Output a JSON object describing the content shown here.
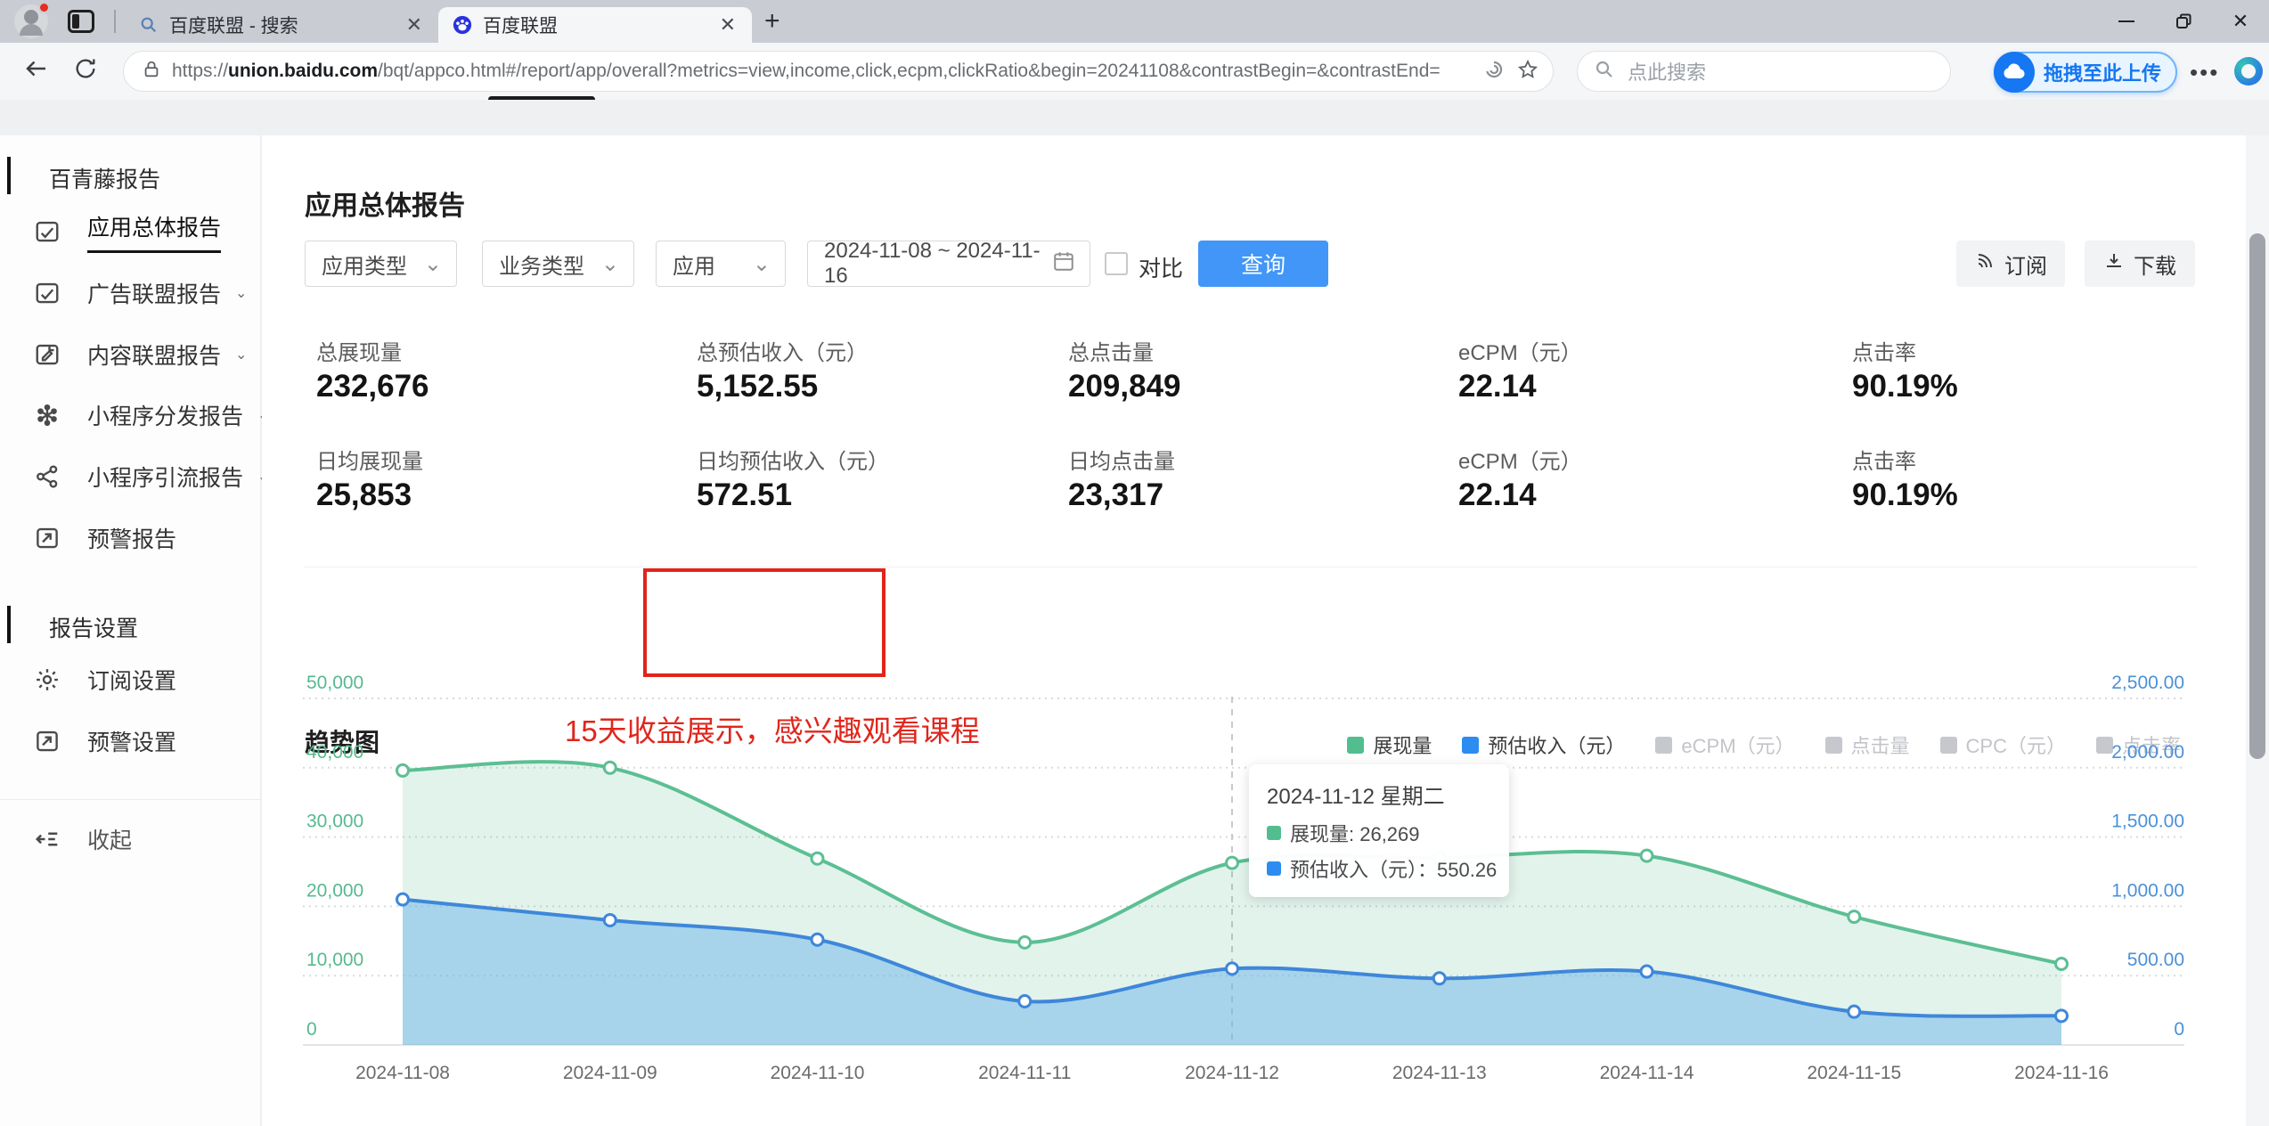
{
  "browser": {
    "tabs": [
      {
        "title": "百度联盟 - 搜索",
        "favicon": "search-icon",
        "active": false
      },
      {
        "title": "百度联盟",
        "favicon": "baidu-paw-icon",
        "active": true
      }
    ],
    "url_scheme": "https://",
    "url_host": "union.baidu.com",
    "url_path": "/bqt/appco.html#/report/app/overall?metrics=view,income,click,ecpm,clickRatio&begin=20241108&contrastBegin=&contrastEnd=",
    "search_placeholder": "点此搜索",
    "upload_label": "拖拽至此上传"
  },
  "sidebar": {
    "section_report": "百青藤报告",
    "items": [
      {
        "label": "应用总体报告",
        "icon": "report-chart-icon",
        "active": true,
        "expandable": false
      },
      {
        "label": "广告联盟报告",
        "icon": "report-chart-icon",
        "active": false,
        "expandable": true
      },
      {
        "label": "内容联盟报告",
        "icon": "content-report-icon",
        "active": false,
        "expandable": true
      },
      {
        "label": "小程序分发报告",
        "icon": "mini-program-distribute-icon",
        "active": false,
        "expandable": true
      },
      {
        "label": "小程序引流报告",
        "icon": "share-icon",
        "active": false,
        "expandable": true
      },
      {
        "label": "预警报告",
        "icon": "alert-report-icon",
        "active": false,
        "expandable": false
      }
    ],
    "section_settings": "报告设置",
    "settings_items": [
      {
        "label": "订阅设置",
        "icon": "gear-icon"
      },
      {
        "label": "预警设置",
        "icon": "alert-report-icon"
      }
    ],
    "collapse_label": "收起"
  },
  "main": {
    "page_title": "应用总体报告",
    "filters": {
      "app_type": "应用类型",
      "biz_type": "业务类型",
      "app": "应用",
      "date_range": "2024-11-08 ~ 2024-11-16",
      "compare_label": "对比",
      "query_label": "查询",
      "subscribe_label": "订阅",
      "download_label": "下载"
    },
    "stats": {
      "row1": [
        {
          "label": "总展现量",
          "value": "232,676"
        },
        {
          "label": "总预估收入（元）",
          "value": "5,152.55"
        },
        {
          "label": "总点击量",
          "value": "209,849"
        },
        {
          "label": "eCPM（元）",
          "value": "22.14"
        },
        {
          "label": "点击率",
          "value": "90.19%"
        }
      ],
      "row2": [
        {
          "label": "日均展现量",
          "value": "25,853"
        },
        {
          "label": "日均预估收入（元）",
          "value": "572.51",
          "highlighted": true
        },
        {
          "label": "日均点击量",
          "value": "23,317"
        },
        {
          "label": "eCPM（元）",
          "value": "22.14"
        },
        {
          "label": "点击率",
          "value": "90.19%"
        }
      ]
    },
    "annotation": "15天收益展示，感兴趣观看课程",
    "chart_title": "趋势图",
    "highlight_color": "#e0251b"
  },
  "chart_data": {
    "type": "area",
    "title": "趋势图",
    "x": [
      "2024-11-08",
      "2024-11-09",
      "2024-11-10",
      "2024-11-11",
      "2024-11-12",
      "2024-11-13",
      "2024-11-14",
      "2024-11-15",
      "2024-11-16"
    ],
    "series": [
      {
        "name": "展现量",
        "axis": "left",
        "color": "#52be90",
        "line_color": "#5cbf93",
        "fill": "rgba(92,191,147,0.18)",
        "values": [
          39600,
          40000,
          26900,
          14800,
          26269,
          27000,
          27300,
          18500,
          11700
        ]
      },
      {
        "name": "预估收入（元）",
        "axis": "right",
        "color": "#2d8cf0",
        "line_color": "#3e87da",
        "fill": "rgba(118,186,233,0.55)",
        "values": [
          1050,
          900,
          760,
          315,
          550.26,
          480,
          530,
          240,
          210
        ]
      }
    ],
    "legend_disabled": [
      "eCPM（元）",
      "点击量",
      "CPC（元）",
      "点击率"
    ],
    "legend_disabled_color": "#c6c8cd",
    "left_axis": {
      "min": 0,
      "max": 50000,
      "ticks": [
        "0",
        "10,000",
        "20,000",
        "30,000",
        "40,000",
        "50,000"
      ],
      "color": "#56b98f"
    },
    "right_axis": {
      "min": 0,
      "max": 2500,
      "ticks": [
        "0",
        "500.00",
        "1,000.00",
        "1,500.00",
        "2,000.00",
        "2,500.00"
      ],
      "color": "#4a90d9"
    },
    "tooltip": {
      "index": 4,
      "title": "2024-11-12 星期二",
      "rows": [
        {
          "label": "展现量",
          "value": "26,269",
          "color": "#52be90"
        },
        {
          "label": "预估收入（元）",
          "value": "550.26",
          "color": "#2d8cf0"
        }
      ]
    },
    "grid": "dotted-horizontal",
    "legend_position": "top-right"
  }
}
